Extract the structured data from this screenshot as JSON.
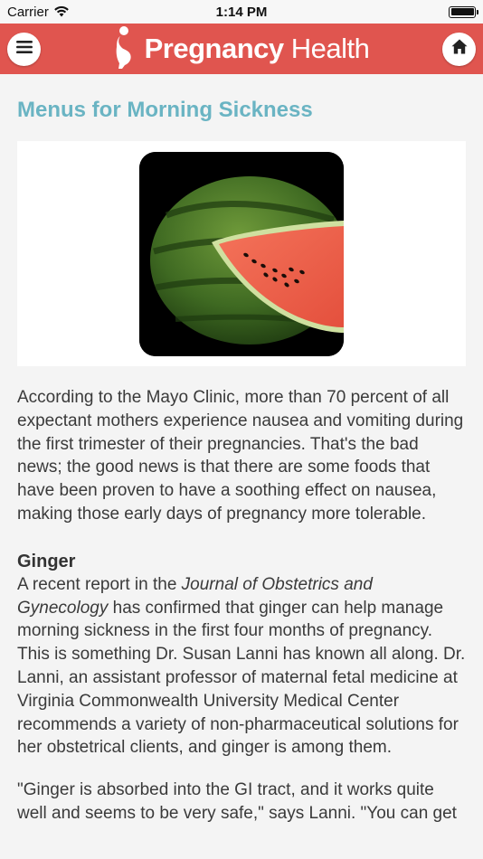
{
  "status_bar": {
    "carrier": "Carrier",
    "time": "1:14 PM"
  },
  "header": {
    "brand_bold": "Pregnancy",
    "brand_light": "Health",
    "bar_color": "#e0554f",
    "menu_icon": "hamburger-menu-icon",
    "home_icon": "home-icon"
  },
  "article": {
    "title": "Menus for Morning Sickness",
    "title_color": "#6ab4c3",
    "image_subject": "watermelon-image",
    "intro": "According to the Mayo Clinic, more than 70 percent of all expectant mothers experience nausea and vomiting during the first trimester of their pregnancies. That's the bad news; the good news is that there are some foods that have been proven to have a soothing effect on nausea, making those early days of pregnancy more tolerable.",
    "section_heading": "Ginger",
    "section_lead": "A recent report in the ",
    "journal_name": "Journal of Obstetrics and Gynecology",
    "section_body": " has confirmed that ginger can help manage morning sickness in the first four months of pregnancy. This is something Dr. Susan Lanni has known all along. Dr. Lanni, an assistant professor of maternal fetal medicine at Virginia Commonwealth University Medical Center recommends a variety of non-pharmaceutical solutions for her obstetrical clients, and ginger is among them.",
    "quote": "\"Ginger is absorbed into the GI tract, and it works quite well and seems to be very safe,\" says Lanni. \"You can get"
  }
}
